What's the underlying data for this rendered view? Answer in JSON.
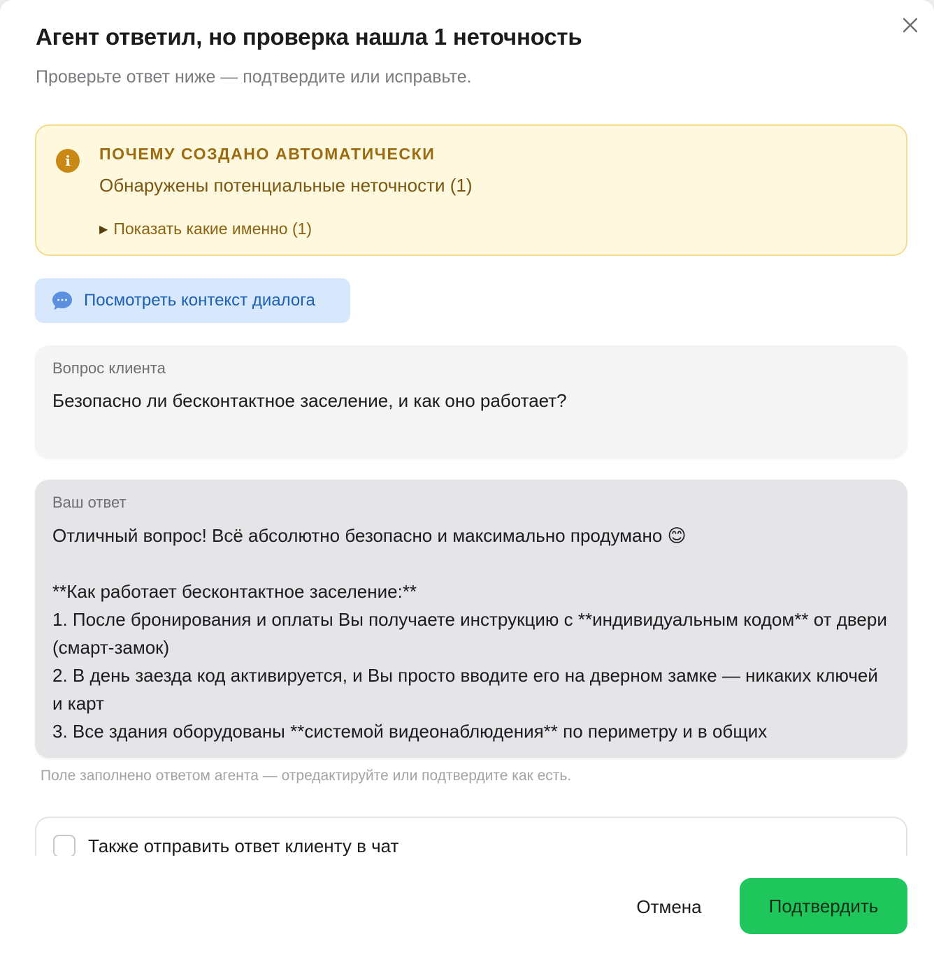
{
  "dialog": {
    "title": "Агент ответил, но проверка нашла 1 неточность",
    "subtitle": "Проверьте ответ ниже — подтвердите или исправьте.",
    "close_icon": "close-icon"
  },
  "notice": {
    "icon": "info-icon",
    "heading": "ПОЧЕМУ СОЗДАНО АВТОМАТИЧЕСКИ",
    "text": "Обнаружены потенциальные неточности (1)",
    "toggle_label": "Показать какие именно (1)",
    "background": "#fdf8de",
    "border": "#f3dc92",
    "accent": "#c98713"
  },
  "context_button": {
    "icon": "chat-bubble-icon",
    "label": "Посмотреть контекст диалога"
  },
  "question": {
    "label": "Вопрос клиента",
    "text": "Безопасно ли бесконтактное заселение, и как оно работает?"
  },
  "answer": {
    "label": "Ваш ответ",
    "value": "Отличный вопрос! Всё абсолютно безопасно и максимально продумано 😊\n\n**Как работает бесконтактное заселение:**\n1. После бронирования и оплаты Вы получаете инструкцию с **индивидуальным кодом** от двери (смарт-замок)\n2. В день заезда код активируется, и Вы просто вводите его на дверном замке — никаких ключей и карт\n3. Все здания оборудованы **системой видеонаблюдения** по периметру и в общих",
    "hint": "Поле заполнено ответом агента — отредактируйте или подтвердите как есть."
  },
  "send_to_chat": {
    "label": "Также отправить ответ клиенту в чат",
    "checked": false
  },
  "footer": {
    "cancel_label": "Отмена",
    "confirm_label": "Подтвердить",
    "confirm_color": "#1fc65b"
  }
}
